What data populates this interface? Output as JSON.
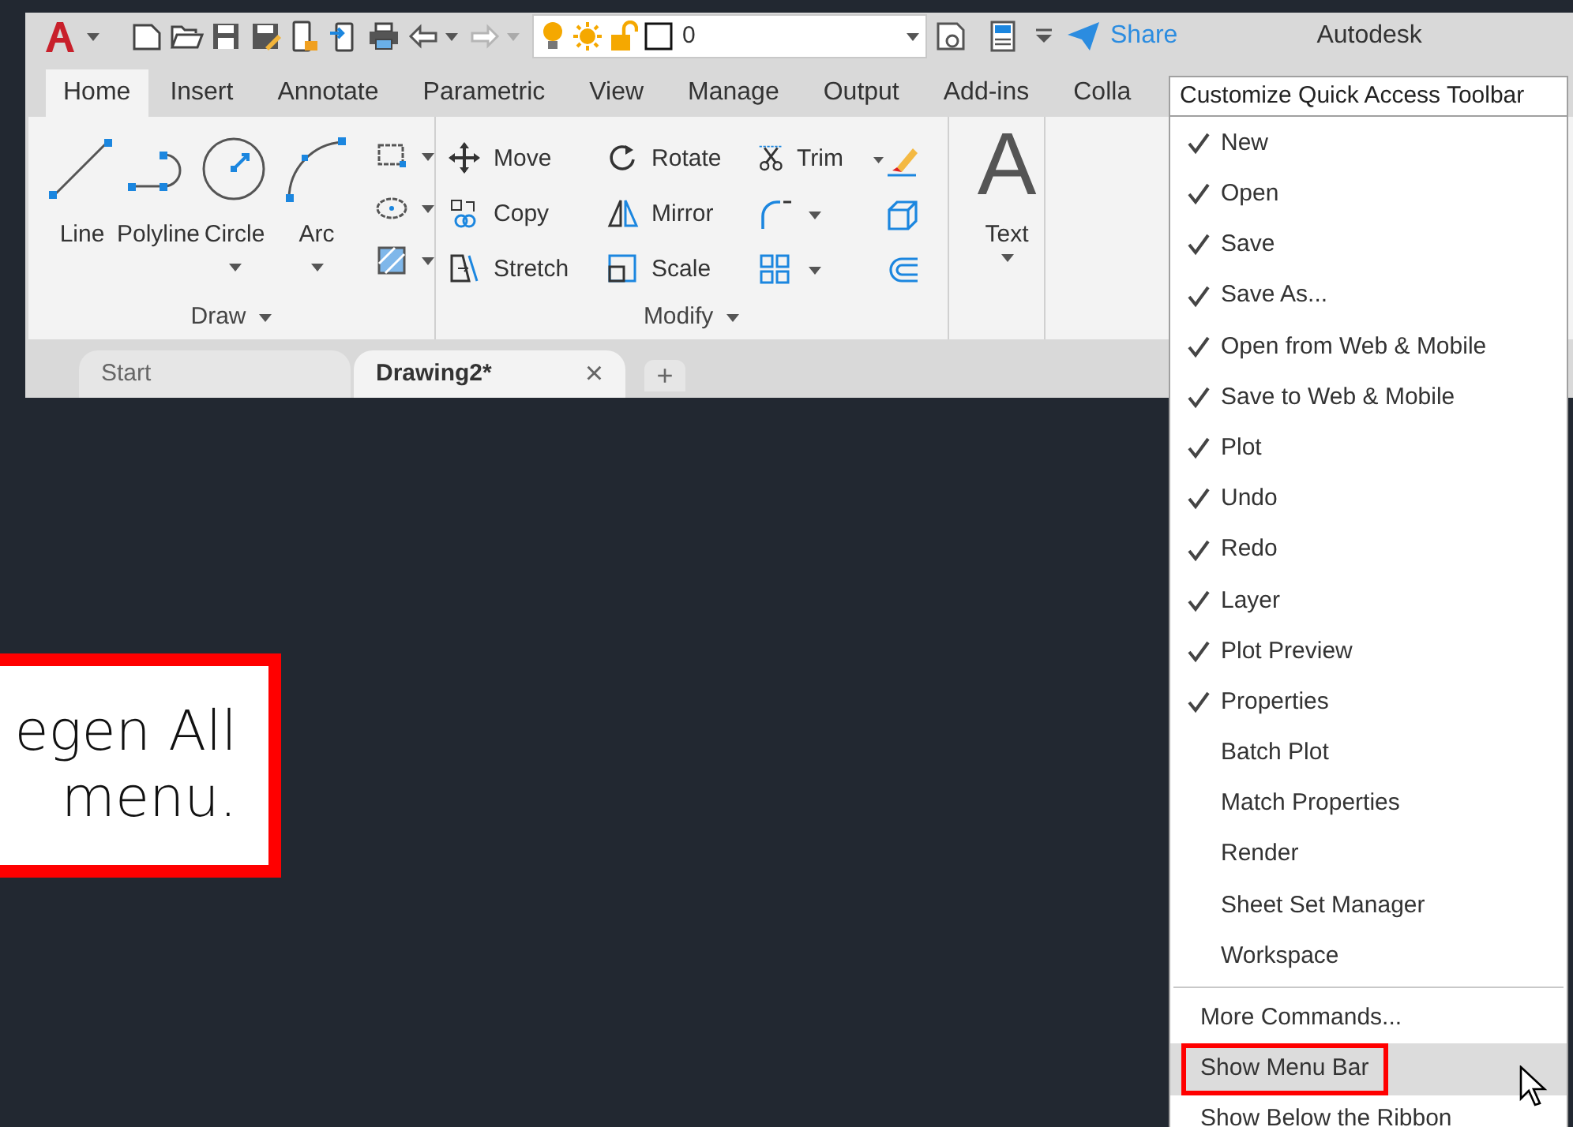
{
  "quick_access": {
    "layer": "0",
    "share": "Share",
    "app_title": "Autodesk"
  },
  "ribbon_tabs": [
    {
      "label": "Home",
      "selected": true
    },
    {
      "label": "Insert",
      "selected": false
    },
    {
      "label": "Annotate",
      "selected": false
    },
    {
      "label": "Parametric",
      "selected": false
    },
    {
      "label": "View",
      "selected": false
    },
    {
      "label": "Manage",
      "selected": false
    },
    {
      "label": "Output",
      "selected": false
    },
    {
      "label": "Add-ins",
      "selected": false
    },
    {
      "label": "Colla",
      "selected": false
    }
  ],
  "draw_panel": {
    "title": "Draw",
    "tools": [
      {
        "label": "Line",
        "dropdown": false
      },
      {
        "label": "Polyline",
        "dropdown": false
      },
      {
        "label": "Circle",
        "dropdown": true
      },
      {
        "label": "Arc",
        "dropdown": true
      }
    ]
  },
  "modify_panel": {
    "title": "Modify",
    "rows": [
      [
        {
          "label": "Move",
          "dropdown": false
        },
        {
          "label": "Rotate",
          "dropdown": false
        },
        {
          "label": "Trim",
          "dropdown": true
        }
      ],
      [
        {
          "label": "Copy",
          "dropdown": false
        },
        {
          "label": "Mirror",
          "dropdown": false
        }
      ],
      [
        {
          "label": "Stretch",
          "dropdown": false
        },
        {
          "label": "Scale",
          "dropdown": false
        }
      ]
    ]
  },
  "annotation_panel": {
    "glyph": "A",
    "label": "Text"
  },
  "doc_tabs": [
    {
      "label": "Start",
      "selected": false
    },
    {
      "label": "Drawing2*",
      "selected": true,
      "close": "×"
    }
  ],
  "new_tab": "+",
  "menu": {
    "title": "Customize Quick Access Toolbar",
    "items": [
      {
        "label": "New",
        "checked": true
      },
      {
        "label": "Open",
        "checked": true
      },
      {
        "label": "Save",
        "checked": true
      },
      {
        "label": "Save As...",
        "checked": true
      },
      {
        "label": "Open from Web & Mobile",
        "checked": true
      },
      {
        "label": "Save to Web & Mobile",
        "checked": true
      },
      {
        "label": "Plot",
        "checked": true
      },
      {
        "label": "Undo",
        "checked": true
      },
      {
        "label": "Redo",
        "checked": true
      },
      {
        "label": "Layer",
        "checked": true
      },
      {
        "label": "Plot Preview",
        "checked": true
      },
      {
        "label": "Properties",
        "checked": true
      },
      {
        "label": "Batch Plot",
        "checked": false
      },
      {
        "label": "Match Properties",
        "checked": false
      },
      {
        "label": "Render",
        "checked": false
      },
      {
        "label": "Sheet Set Manager",
        "checked": false
      },
      {
        "label": "Workspace",
        "checked": false
      }
    ],
    "options": [
      {
        "label": "More Commands...",
        "selected": false,
        "annotated": false
      },
      {
        "label": "Show Menu Bar",
        "selected": true,
        "annotated": true
      },
      {
        "label": "Show Below the Ribbon",
        "selected": false,
        "annotated": false
      }
    ]
  },
  "callout": {
    "lines": [
      "egen All",
      "menu."
    ]
  }
}
